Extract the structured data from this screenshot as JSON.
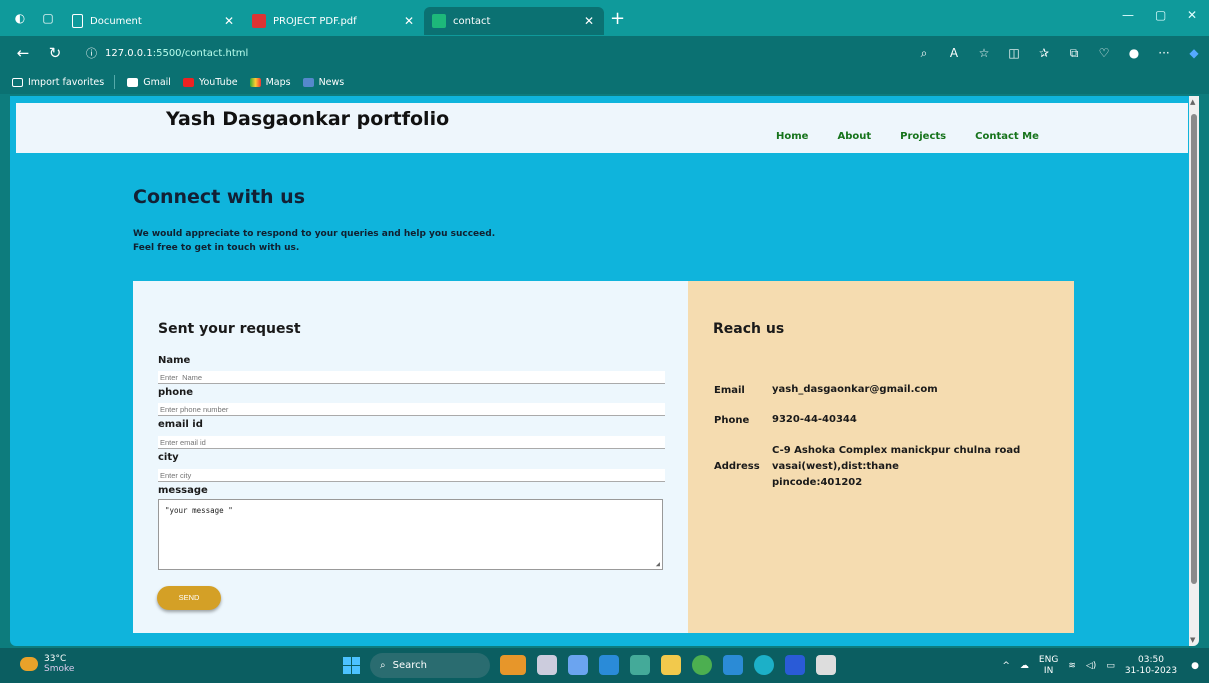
{
  "browser": {
    "tabs": [
      {
        "title": "Document"
      },
      {
        "title": "PROJECT PDF.pdf"
      },
      {
        "title": "contact"
      }
    ],
    "url_host": "127.0.0.1",
    "url_path": ":5500/contact.html",
    "favorites": [
      {
        "label": "Import favorites"
      },
      {
        "label": "Gmail"
      },
      {
        "label": "YouTube"
      },
      {
        "label": "Maps"
      },
      {
        "label": "News"
      }
    ]
  },
  "site": {
    "title": "Yash Dasgaonkar portfolio",
    "nav": [
      "Home",
      "About",
      "Projects",
      "Contact Me"
    ],
    "hero_title": "Connect with us",
    "hero_line1": "We would appreciate to respond to your queries and help you succeed.",
    "hero_line2": "Feel free to get in touch with us."
  },
  "form": {
    "heading": "Sent your request",
    "fields": [
      {
        "label": "Name",
        "placeholder": "Enter  Name"
      },
      {
        "label": "phone",
        "placeholder": "Enter phone number"
      },
      {
        "label": "email id",
        "placeholder": "Enter email id"
      },
      {
        "label": "city",
        "placeholder": "Enter city"
      }
    ],
    "message_label": "message",
    "message_value": "\"your message \"",
    "send_label": "SEND"
  },
  "reach": {
    "heading": "Reach us",
    "email_label": "Email",
    "email_value": "yash_dasgaonkar@gmail.com",
    "phone_label": "Phone",
    "phone_value": "9320-44-40344",
    "address_label": "Address",
    "address_line1": "C-9 Ashoka Complex manickpur chulna road",
    "address_line2": "vasai(west),dist:thane",
    "address_line3": "pincode:401202"
  },
  "taskbar": {
    "temp": "33°C",
    "weather": "Smoke",
    "search": "Search",
    "lang1": "ENG",
    "lang2": "IN",
    "time": "03:50",
    "date": "31-10-2023"
  }
}
